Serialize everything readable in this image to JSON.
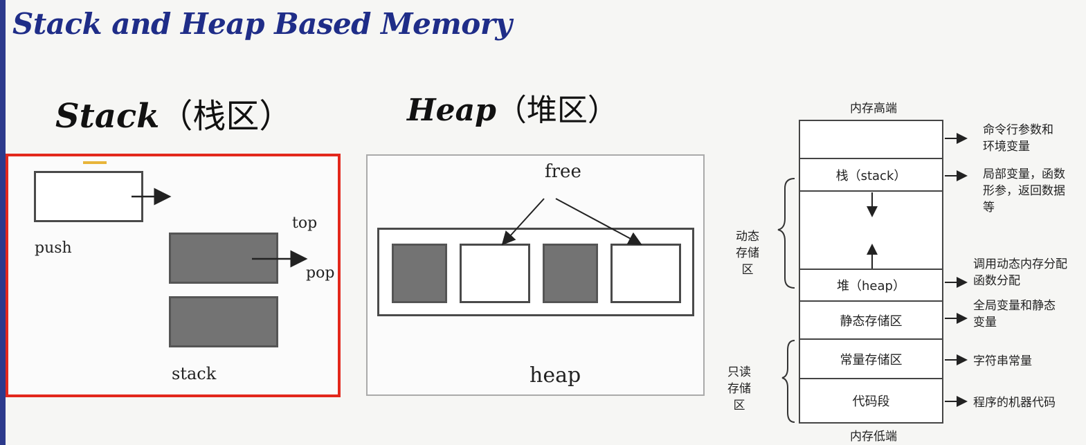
{
  "title": "Stack and Heap Based Memory",
  "stack": {
    "heading_latin": "Stack",
    "heading_cjk": "（栈区）",
    "push_label": "push",
    "top_label": "top",
    "pop_label": "pop",
    "caption": "stack"
  },
  "heap": {
    "heading_latin": "Heap",
    "heading_cjk": "（堆区）",
    "free_label": "free",
    "caption": "heap"
  },
  "memory_layout": {
    "high_label": "内存高端",
    "low_label": "内存低端",
    "segments": {
      "env": "",
      "stack": "栈（stack）",
      "gap": "",
      "heap": "堆（heap）",
      "static": "静态存储区",
      "constant": "常量存储区",
      "code": "代码段"
    },
    "notes": {
      "env": "命令行参数和环境变量",
      "stack": "局部变量，函数形参，返回数据等",
      "heap": "调用动态内存分配函数分配",
      "static": "全局变量和静态变量",
      "constant": "字符串常量",
      "code": "程序的机器代码"
    },
    "groups": {
      "dynamic": "动态存储区",
      "readonly": "只读存储区"
    }
  },
  "colors": {
    "title": "#1f2d88",
    "stack_border": "#e3281c",
    "block_gray": "#737373"
  }
}
